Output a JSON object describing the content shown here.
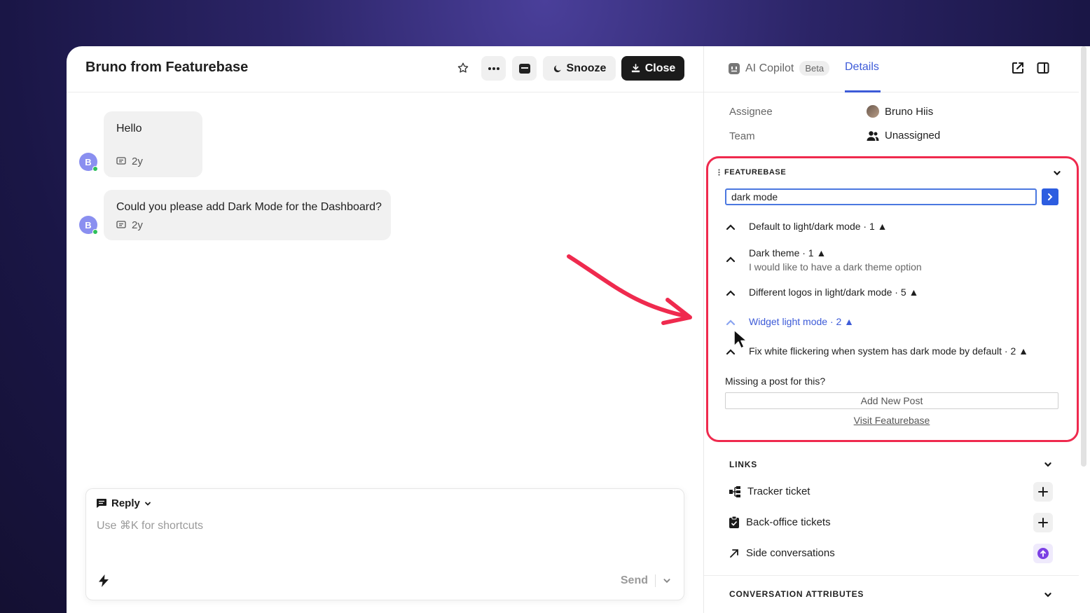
{
  "conversation": {
    "title": "Bruno from Featurebase",
    "actions": {
      "snooze_label": "Snooze",
      "close_label": "Close"
    },
    "messages": [
      {
        "avatar": "B",
        "text": "Hello",
        "time": "2y"
      },
      {
        "avatar": "B",
        "text": "Could you please add Dark Mode for the Dashboard?",
        "time": "2y"
      }
    ],
    "composer": {
      "mode_label": "Reply",
      "placeholder": "Use ⌘K for shortcuts",
      "send_label": "Send"
    }
  },
  "side_panel": {
    "tabs": {
      "copilot_label": "AI Copilot",
      "beta_badge": "Beta",
      "details_label": "Details"
    },
    "attributes": [
      {
        "label": "Assignee",
        "value": "Bruno Hiis"
      },
      {
        "label": "Team",
        "value": "Unassigned"
      }
    ],
    "featurebase": {
      "section_title": "FEATUREBASE",
      "search_value": "dark mode",
      "results": [
        {
          "title": "Default to light/dark mode · 1 ▲",
          "subtitle": ""
        },
        {
          "title": "Dark theme · 1 ▲",
          "subtitle": "I would like to have a dark theme option"
        },
        {
          "title": "Different logos in light/dark mode · 5 ▲",
          "subtitle": ""
        },
        {
          "title": "Widget light mode · 2 ▲",
          "subtitle": ""
        },
        {
          "title": "Fix white flickering when system has dark mode by default · 2 ▲",
          "subtitle": ""
        }
      ],
      "missing_text": "Missing a post for this?",
      "add_button_label": "Add New Post",
      "visit_link_label": "Visit Featurebase"
    },
    "links": {
      "section_title": "LINKS",
      "items": [
        {
          "label": "Tracker ticket",
          "icon": "tracker-icon"
        },
        {
          "label": "Back-office tickets",
          "icon": "clipboard-icon"
        },
        {
          "label": "Side conversations",
          "icon": "arrow-up-right-icon"
        }
      ]
    },
    "conversation_attributes": {
      "section_title": "CONVERSATION ATTRIBUTES"
    }
  },
  "colors": {
    "accent": "#3d5bd8",
    "highlight": "#ef2a4e",
    "online": "#2ec05a"
  }
}
